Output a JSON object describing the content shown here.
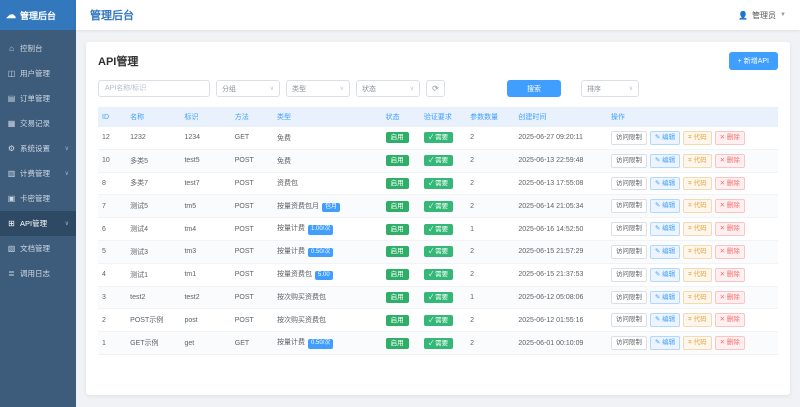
{
  "app": {
    "brand": "管理后台",
    "header_title": "管理后台",
    "user": "管理员"
  },
  "colors": {
    "primary": "#409eff",
    "sidebar": "#3d5b7b",
    "logo": "#3377bd",
    "success": "#2fae68"
  },
  "sidebar": {
    "items": [
      {
        "id": "console",
        "label": "控制台",
        "icon": "⌂",
        "arrow": false,
        "active": false
      },
      {
        "id": "users",
        "label": "用户管理",
        "icon": "◫",
        "arrow": false,
        "active": false
      },
      {
        "id": "orders",
        "label": "订单管理",
        "icon": "▤",
        "arrow": false,
        "active": false
      },
      {
        "id": "trades",
        "label": "交易记录",
        "icon": "▦",
        "arrow": false,
        "active": false
      },
      {
        "id": "system",
        "label": "系统设置",
        "icon": "⚙",
        "arrow": true,
        "active": false
      },
      {
        "id": "billing",
        "label": "计费管理",
        "icon": "▥",
        "arrow": true,
        "active": false
      },
      {
        "id": "cardkeys",
        "label": "卡密管理",
        "icon": "▣",
        "arrow": false,
        "active": false
      },
      {
        "id": "api",
        "label": "API管理",
        "icon": "⊞",
        "arrow": true,
        "active": true
      },
      {
        "id": "docs",
        "label": "文档管理",
        "icon": "▧",
        "arrow": false,
        "active": false
      },
      {
        "id": "logs",
        "label": "调用日志",
        "icon": "≣",
        "arrow": false,
        "active": false
      }
    ]
  },
  "page": {
    "title": "API管理",
    "add_button": "+ 新增API"
  },
  "filters": {
    "keyword_placeholder": "API名称/标识",
    "selects": [
      {
        "label": "分组"
      },
      {
        "label": "类型"
      },
      {
        "label": "状态"
      }
    ],
    "refresh_icon": "⟳",
    "search_button": "搜索",
    "sort_select": "排序",
    "caret": "∨"
  },
  "table": {
    "headers": [
      "ID",
      "名称",
      "标识",
      "方法",
      "类型",
      "状态",
      "验证要求",
      "参数数量",
      "创建时间",
      "操作"
    ],
    "status_label": "启用",
    "verify_label": "✓ 需要",
    "actions": [
      {
        "label": "访问限制",
        "style": "act-plain",
        "icon": ""
      },
      {
        "label": "编辑",
        "style": "act-edit",
        "icon": "✎"
      },
      {
        "label": "代码",
        "style": "act-code",
        "icon": "⌗"
      },
      {
        "label": "删除",
        "style": "act-del",
        "icon": "✕"
      }
    ],
    "rows": [
      {
        "id": 12,
        "name": "1232",
        "key": "1234",
        "method": "GET",
        "type": "免费",
        "type_badge": "",
        "params": 2,
        "created": "2025-06-27 09:20:11"
      },
      {
        "id": 10,
        "name": "多类5",
        "key": "test5",
        "method": "POST",
        "type": "免费",
        "type_badge": "",
        "params": 2,
        "created": "2025-06-13 22:59:48"
      },
      {
        "id": 8,
        "name": "多类7",
        "key": "test7",
        "method": "POST",
        "type": "资费包",
        "type_badge": "",
        "params": 2,
        "created": "2025-06-13 17:55:08"
      },
      {
        "id": 7,
        "name": "测试5",
        "key": "tm5",
        "method": "POST",
        "type": "按量资费包月",
        "type_badge": "包月",
        "params": 2,
        "created": "2025-06-14 21:05:34"
      },
      {
        "id": 6,
        "name": "测试4",
        "key": "tm4",
        "method": "POST",
        "type": "按量计费",
        "type_badge": "1.00/次",
        "params": 1,
        "created": "2025-06-16 14:52:50"
      },
      {
        "id": 5,
        "name": "测试3",
        "key": "tm3",
        "method": "POST",
        "type": "按量计费",
        "type_badge": "0.50/次",
        "params": 2,
        "created": "2025-06-15 21:57:29"
      },
      {
        "id": 4,
        "name": "测试1",
        "key": "tm1",
        "method": "POST",
        "type": "按量资费包",
        "type_badge": "5.00",
        "params": 2,
        "created": "2025-06-15 21:37:53"
      },
      {
        "id": 3,
        "name": "test2",
        "key": "test2",
        "method": "POST",
        "type": "按次购买资费包",
        "type_badge": "",
        "params": 1,
        "created": "2025-06-12 05:08:06"
      },
      {
        "id": 2,
        "name": "POST示例",
        "key": "post",
        "method": "POST",
        "type": "按次购买资费包",
        "type_badge": "",
        "params": 2,
        "created": "2025-06-12 01:55:16"
      },
      {
        "id": 1,
        "name": "GET示例",
        "key": "get",
        "method": "GET",
        "type": "按量计费",
        "type_badge": "0.50/次",
        "params": 2,
        "created": "2025-06-01 00:10:09"
      }
    ]
  }
}
